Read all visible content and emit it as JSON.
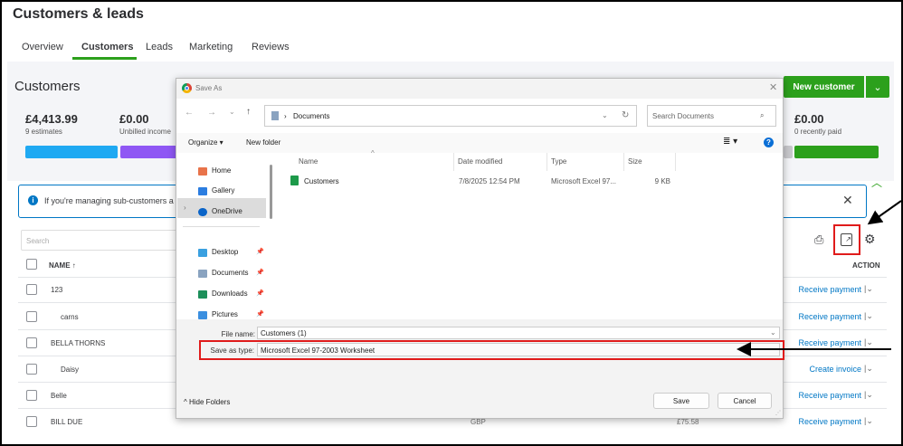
{
  "page": {
    "title": "Customers & leads"
  },
  "tabs": [
    {
      "label": "Overview"
    },
    {
      "label": "Customers"
    },
    {
      "label": "Leads"
    },
    {
      "label": "Marketing"
    },
    {
      "label": "Reviews"
    }
  ],
  "customers": {
    "heading": "Customers",
    "new_customer": "New customer",
    "summary": [
      {
        "amount": "£4,413.99",
        "label": "9 estimates",
        "color": "#1fa9f2"
      },
      {
        "amount": "£0.00",
        "label": "Unbilled income",
        "color": "#8f57f4"
      },
      {
        "amount": "£0.00",
        "label": "0 recently paid",
        "color": "#2ca01c"
      }
    ],
    "info": "If you're managing sub-customers a",
    "search_placeholder": "Search",
    "columns": {
      "name": "NAME ↑",
      "action": "ACTION"
    },
    "rows": [
      {
        "name": "123",
        "action": "Receive payment"
      },
      {
        "name": "carns",
        "action": "Receive payment"
      },
      {
        "name": "BELLA THORNS",
        "action": "Receive payment"
      },
      {
        "name": "Daisy",
        "action": "Create invoice"
      },
      {
        "name": "Belle",
        "action": "Receive payment"
      },
      {
        "name": "BILL DUE",
        "action": "Receive payment",
        "currency": "GBP",
        "balance": "£75.58"
      }
    ]
  },
  "dialog": {
    "title": "Save As",
    "path": "Documents",
    "search_placeholder": "Search Documents",
    "organize": "Organize ▾",
    "new_folder": "New folder",
    "nav": [
      {
        "label": "Home"
      },
      {
        "label": "Gallery"
      },
      {
        "label": "OneDrive"
      },
      {
        "label": "Desktop"
      },
      {
        "label": "Documents"
      },
      {
        "label": "Downloads"
      },
      {
        "label": "Pictures"
      }
    ],
    "columns": [
      "Name",
      "Date modified",
      "Type",
      "Size"
    ],
    "files": [
      {
        "name": "Customers",
        "date": "7/8/2025 12:54 PM",
        "type": "Microsoft Excel 97...",
        "size": "9 KB"
      }
    ],
    "file_name_label": "File name:",
    "file_name": "Customers (1)",
    "type_label": "Save as type:",
    "type_value": "Microsoft Excel 97-2003 Worksheet",
    "hide_folders": "Hide Folders",
    "save": "Save",
    "cancel": "Cancel"
  }
}
